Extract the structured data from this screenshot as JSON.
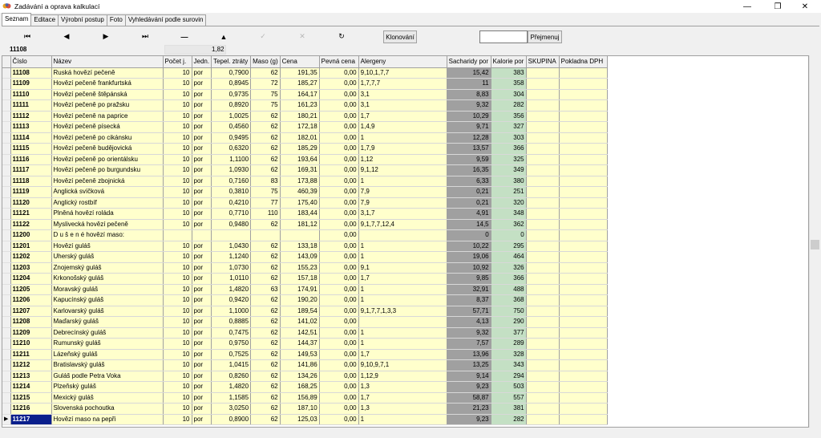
{
  "window": {
    "title": "Zadávání a oprava kalkulací"
  },
  "tabs": [
    "Seznam",
    "Editace",
    "Výrobní postup",
    "Foto",
    "Vyhledávání podle surovin"
  ],
  "nav": {
    "klonovani_label": "Klonování",
    "prejmenuj_label": "Přejmenuj",
    "rename_value": ""
  },
  "info": {
    "code": "11108",
    "value": "1,82"
  },
  "columns": [
    "Číslo",
    "Název",
    "Počet j.",
    "Jedn.",
    "Tepel. ztráty",
    "Maso (g)",
    "Cena",
    "Pevná cena",
    "Alergeny",
    "Sacharidy por",
    "Kalorie por",
    "SKUPINA",
    "Pokladna DPH"
  ],
  "rows": [
    [
      "11108",
      "Ruská hovězí pečeně",
      "10",
      "por",
      "0,7900",
      "62",
      "191,35",
      "0,00",
      "9,10,1,7,7",
      "15,42",
      "383"
    ],
    [
      "11109",
      "Hovězí pečeně frankfurtská",
      "10",
      "por",
      "0,8945",
      "72",
      "185,27",
      "0,00",
      "1,7,7,7",
      "11",
      "358"
    ],
    [
      "11110",
      "Hovězí pečeně štěpánská",
      "10",
      "por",
      "0,9735",
      "75",
      "164,17",
      "0,00",
      "3,1",
      "8,83",
      "304"
    ],
    [
      "11111",
      "Hovězí pečeně po pražsku",
      "10",
      "por",
      "0,8920",
      "75",
      "161,23",
      "0,00",
      "3,1",
      "9,32",
      "282"
    ],
    [
      "11112",
      "Hovězí pečeně na paprice",
      "10",
      "por",
      "1,0025",
      "62",
      "180,21",
      "0,00",
      "1,7",
      "10,29",
      "356"
    ],
    [
      "11113",
      "Hovězí pečeně písecká",
      "10",
      "por",
      "0,4560",
      "62",
      "172,18",
      "0,00",
      "1,4,9",
      "9,71",
      "327"
    ],
    [
      "11114",
      "Hovězí pečeně po cikánsku",
      "10",
      "por",
      "0,9495",
      "62",
      "182,01",
      "0,00",
      "1",
      "12,28",
      "303"
    ],
    [
      "11115",
      "Hovězí pečeně budějovická",
      "10",
      "por",
      "0,6320",
      "62",
      "185,29",
      "0,00",
      "1,7,9",
      "13,57",
      "366"
    ],
    [
      "11116",
      "Hovězí pečeně po orientálsku",
      "10",
      "por",
      "1,1100",
      "62",
      "193,64",
      "0,00",
      "1,12",
      "9,59",
      "325"
    ],
    [
      "11117",
      "Hovězí pečeně po burgundsku",
      "10",
      "por",
      "1,0930",
      "62",
      "169,31",
      "0,00",
      "9,1,12",
      "16,35",
      "349"
    ],
    [
      "11118",
      "Hovězí pečeně zbojnická",
      "10",
      "por",
      "0,7160",
      "83",
      "173,88",
      "0,00",
      "1",
      "6,33",
      "380"
    ],
    [
      "11119",
      "Anglická svíčková",
      "10",
      "por",
      "0,3810",
      "75",
      "460,39",
      "0,00",
      "7,9",
      "0,21",
      "251"
    ],
    [
      "11120",
      "Anglický rostbíf",
      "10",
      "por",
      "0,4210",
      "77",
      "175,40",
      "0,00",
      "7,9",
      "0,21",
      "320"
    ],
    [
      "11121",
      "Plněná hovězí roláda",
      "10",
      "por",
      "0,7710",
      "110",
      "183,44",
      "0,00",
      "3,1,7",
      "4,91",
      "348"
    ],
    [
      "11122",
      "Myslivecká hovězí pečeně",
      "10",
      "por",
      "0,9480",
      "62",
      "181,12",
      "0,00",
      "9,1,7,7,12,4",
      "14,5",
      "362"
    ],
    [
      "11200",
      "D u š e n é  hovězí maso:",
      "",
      "",
      "",
      "",
      "",
      "0,00",
      "",
      "0",
      "0"
    ],
    [
      "11201",
      "Hovězí guláš",
      "10",
      "por",
      "1,0430",
      "62",
      "133,18",
      "0,00",
      "1",
      "10,22",
      "295"
    ],
    [
      "11202",
      "Uherský guláš",
      "10",
      "por",
      "1,1240",
      "62",
      "143,09",
      "0,00",
      "1",
      "19,06",
      "464"
    ],
    [
      "11203",
      "Znojemský guláš",
      "10",
      "por",
      "1,0730",
      "62",
      "155,23",
      "0,00",
      "9,1",
      "10,92",
      "326"
    ],
    [
      "11204",
      "Krkonošský guláš",
      "10",
      "por",
      "1,0110",
      "62",
      "157,18",
      "0,00",
      "1,7",
      "9,85",
      "366"
    ],
    [
      "11205",
      "Moravský guláš",
      "10",
      "por",
      "1,4820",
      "63",
      "174,91",
      "0,00",
      "1",
      "32,91",
      "488"
    ],
    [
      "11206",
      "Kapucínský guláš",
      "10",
      "por",
      "0,9420",
      "62",
      "190,20",
      "0,00",
      "1",
      "8,37",
      "368"
    ],
    [
      "11207",
      "Karlovarský guláš",
      "10",
      "por",
      "1,1000",
      "62",
      "189,54",
      "0,00",
      "9,1,7,7,1,3,3",
      "57,71",
      "750"
    ],
    [
      "11208",
      "Maďarský guláš",
      "10",
      "por",
      "0,8885",
      "62",
      "141,02",
      "0,00",
      "",
      "4,13",
      "290"
    ],
    [
      "11209",
      "Debrecínský guláš",
      "10",
      "por",
      "0,7475",
      "62",
      "142,51",
      "0,00",
      "1",
      "9,32",
      "377"
    ],
    [
      "11210",
      "Rumunský guláš",
      "10",
      "por",
      "0,9750",
      "62",
      "144,37",
      "0,00",
      "1",
      "7,57",
      "289"
    ],
    [
      "11211",
      "Lázeňský guláš",
      "10",
      "por",
      "0,7525",
      "62",
      "149,53",
      "0,00",
      "1,7",
      "13,96",
      "328"
    ],
    [
      "11212",
      "Bratislavský guláš",
      "10",
      "por",
      "1,0415",
      "62",
      "141,86",
      "0,00",
      "9,10,9,7,1",
      "13,25",
      "343"
    ],
    [
      "11213",
      "Guláš podle Petra Voka",
      "10",
      "por",
      "0,8260",
      "62",
      "134,26",
      "0,00",
      "1,12,9",
      "9,14",
      "294"
    ],
    [
      "11214",
      "Plzeňský guláš",
      "10",
      "por",
      "1,4820",
      "62",
      "168,25",
      "0,00",
      "1,3",
      "9,23",
      "503"
    ],
    [
      "11215",
      "Mexický guláš",
      "10",
      "por",
      "1,1585",
      "62",
      "156,89",
      "0,00",
      "1,7",
      "58,87",
      "557"
    ],
    [
      "11216",
      "Slovenská pochoutka",
      "10",
      "por",
      "3,0250",
      "62",
      "187,10",
      "0,00",
      "1,3",
      "21,23",
      "381"
    ],
    [
      "11217",
      "Hovězí maso na pepři",
      "10",
      "por",
      "0,8900",
      "62",
      "125,03",
      "0,00",
      "1",
      "9,23",
      "282"
    ]
  ],
  "selected_row": "11217",
  "colors": {
    "code_bg": "#ffff44",
    "row_bg": "#ffffcc",
    "sacharidy_bg": "#a0a0a0",
    "kalorie_bg": "#c4e0c4",
    "selected_bg": "#0a1f8c"
  }
}
